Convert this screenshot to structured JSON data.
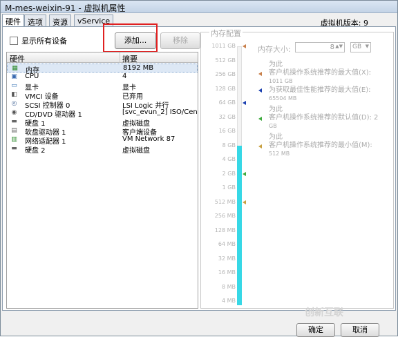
{
  "window": {
    "title": "M-mes-weixin-91 - 虚拟机属性"
  },
  "tabs": [
    "硬件",
    "选项",
    "资源",
    "vService"
  ],
  "version": "虚拟机版本: 9",
  "show_all_devices": {
    "label": "显示所有设备",
    "checked": false
  },
  "buttons": {
    "add": "添加...",
    "remove": "移除",
    "ok": "确定",
    "cancel": "取消"
  },
  "hardware": {
    "col_hardware": "硬件",
    "col_summary": "摘要",
    "rows": [
      {
        "icon": "memory-icon",
        "name": "内存",
        "summary": "8192 MB",
        "selected": true
      },
      {
        "icon": "cpu-icon",
        "name": "CPU",
        "summary": "4"
      },
      {
        "icon": "display-icon",
        "name": "显卡",
        "summary": "显卡"
      },
      {
        "icon": "vmci-icon",
        "name": "VMCI 设备",
        "summary": "已弃用"
      },
      {
        "icon": "scsi-icon",
        "name": "SCSI 控制器 0",
        "summary": "LSI Logic 并行"
      },
      {
        "icon": "cdrom-icon",
        "name": "CD/DVD 驱动器 1",
        "summary": "[svc_evun_2] ISO/Cen..."
      },
      {
        "icon": "disk-icon",
        "name": "硬盘 1",
        "summary": "虚拟磁盘"
      },
      {
        "icon": "floppy-icon",
        "name": "软盘驱动器 1",
        "summary": "客户端设备"
      },
      {
        "icon": "network-icon",
        "name": "网络适配器 1",
        "summary": "VM Network 87"
      },
      {
        "icon": "disk-icon",
        "name": "硬盘 2",
        "summary": "虚拟磁盘"
      }
    ]
  },
  "memory": {
    "section_title": "内存配置",
    "size_label": "内存大小:",
    "size_value": "8",
    "size_unit": "GB",
    "scale_labels": [
      "1011 GB",
      "512 GB",
      "256 GB",
      "128 GB",
      "64 GB",
      "32 GB",
      "16 GB",
      "8 GB",
      "4 GB",
      "2 GB",
      "1 GB",
      "512 MB",
      "256 MB",
      "128 MB",
      "64 MB",
      "32 MB",
      "16 MB",
      "8 MB",
      "4 MB"
    ],
    "current_level_label": "8 GB",
    "recommendations": [
      {
        "prefix": "为此",
        "text": "客户机操作系统推荐的最大值(X):",
        "value": "1011 GB",
        "color": "#c87f4a",
        "tick_label": "1011 GB"
      },
      {
        "prefix": "",
        "text": "为获取最佳性能推荐的最大值(E):",
        "value": "65504 MB",
        "color": "#1a3fb0",
        "tick_label": "64 GB"
      },
      {
        "prefix": "为此",
        "text": "客户机操作系统推荐的默认值(D): 2",
        "value": "GB",
        "color": "#3caa3c",
        "tick_label": "2 GB"
      },
      {
        "prefix": "为此",
        "text": "客户机操作系统推荐的最小值(M):",
        "value": "512 MB",
        "color": "#c8a040",
        "tick_label": "512 MB"
      }
    ]
  },
  "watermark": "创新互联"
}
